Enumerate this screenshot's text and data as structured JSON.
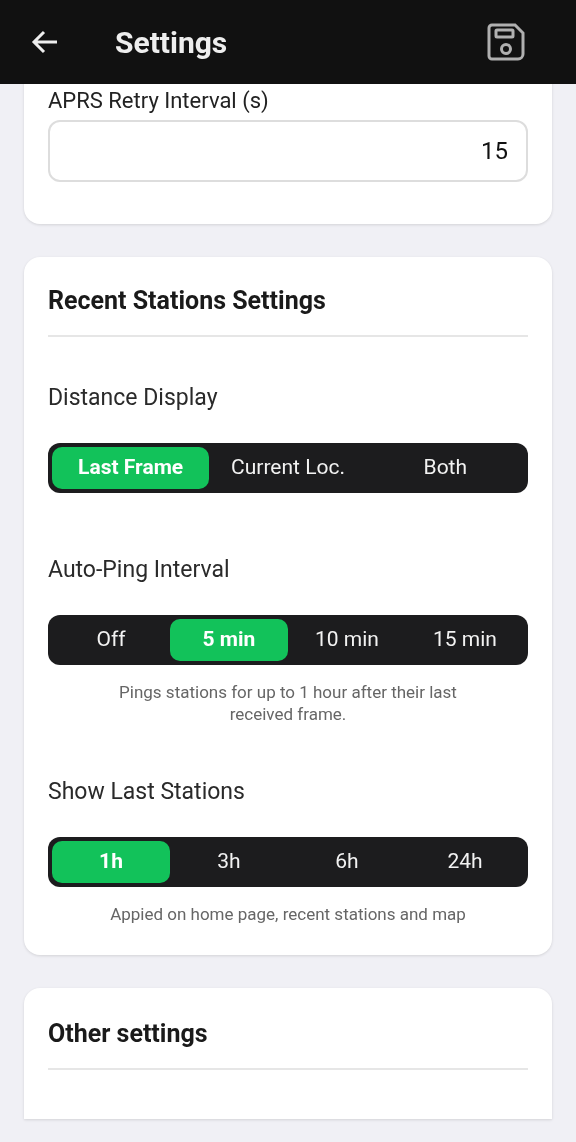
{
  "header": {
    "title": "Settings"
  },
  "aprs_card": {
    "label": "APRS Retry Interval (s)",
    "value": "15"
  },
  "recent_card": {
    "title": "Recent Stations Settings",
    "items": [
      {
        "kind": "label",
        "text": "Distance Display"
      },
      {
        "kind": "segmented",
        "options": [
          {
            "label": "Last Frame",
            "selected": true
          },
          {
            "label": "Current Loc.",
            "selected": false
          },
          {
            "label": "Both",
            "selected": false
          }
        ]
      },
      {
        "kind": "label",
        "text": "Auto-Ping Interval"
      },
      {
        "kind": "segmented",
        "options": [
          {
            "label": "Off",
            "selected": false
          },
          {
            "label": "5 min",
            "selected": true
          },
          {
            "label": "10 min",
            "selected": false
          },
          {
            "label": "15 min",
            "selected": false
          }
        ]
      },
      {
        "kind": "note",
        "text": "Pings stations for up to 1 hour after their last received frame."
      },
      {
        "kind": "label",
        "text": "Show Last Stations"
      },
      {
        "kind": "segmented",
        "options": [
          {
            "label": "1h",
            "selected": true
          },
          {
            "label": "3h",
            "selected": false
          },
          {
            "label": "6h",
            "selected": false
          },
          {
            "label": "24h",
            "selected": false
          }
        ]
      },
      {
        "kind": "note",
        "text": "Appied on home page, recent stations and map"
      }
    ]
  },
  "other_card": {
    "title": "Other settings"
  }
}
